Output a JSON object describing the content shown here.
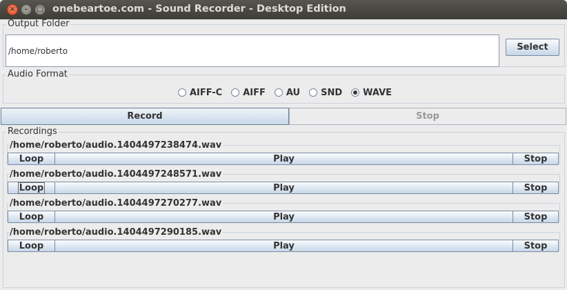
{
  "window": {
    "title": "onebeartoe.com - Sound Recorder - Desktop Edition"
  },
  "output_folder": {
    "label": "Output Folder",
    "path": "/home/roberto",
    "select_label": "Select"
  },
  "audio_format": {
    "label": "Audio Format",
    "options": [
      "AIFF-C",
      "AIFF",
      "AU",
      "SND",
      "WAVE"
    ],
    "selected": "WAVE"
  },
  "controls": {
    "record_label": "Record",
    "stop_label": "Stop"
  },
  "recordings": {
    "label": "Recordings",
    "items": [
      {
        "path": "/home/roberto/audio.1404497238474.wav",
        "loop_label": "Loop",
        "play_label": "Play",
        "stop_label": "Stop"
      },
      {
        "path": "/home/roberto/audio.1404497248571.wav",
        "loop_label": "Loop",
        "play_label": "Play",
        "stop_label": "Stop"
      },
      {
        "path": "/home/roberto/audio.1404497270277.wav",
        "loop_label": "Loop",
        "play_label": "Play",
        "stop_label": "Stop"
      },
      {
        "path": "/home/roberto/audio.1404497290185.wav",
        "loop_label": "Loop",
        "play_label": "Play",
        "stop_label": "Stop"
      }
    ]
  }
}
